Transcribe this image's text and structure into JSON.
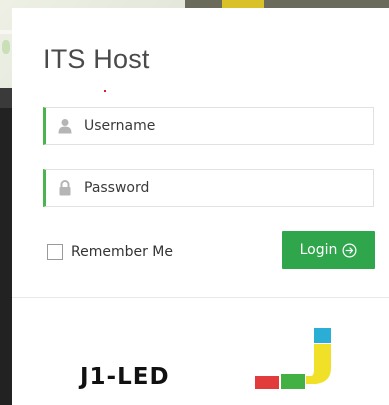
{
  "form": {
    "title": "ITS Host",
    "username_placeholder": "Username",
    "password_placeholder": "Password",
    "remember_label": "Remember Me",
    "login_label": "Login"
  },
  "logo": {
    "text": "J1-LED"
  },
  "colors": {
    "accent_green": "#2fa64b",
    "field_border_green": "#4bb34f",
    "logo_red": "#e23b3b",
    "logo_green": "#43b043",
    "logo_yellow": "#f0e128",
    "logo_cyan": "#2aaed6"
  },
  "icons": {
    "username": "user-icon",
    "password": "lock-icon",
    "login": "arrow-right-circle-icon"
  }
}
